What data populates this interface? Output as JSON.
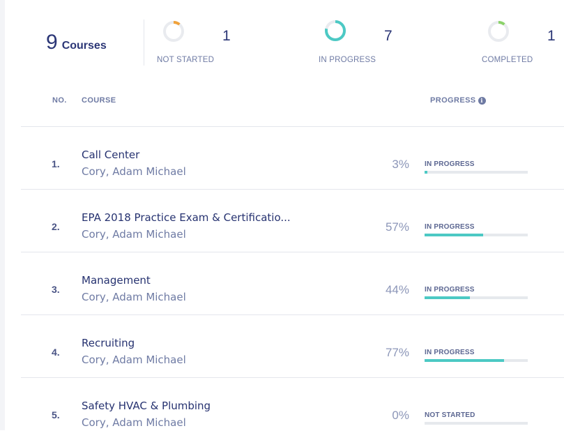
{
  "summary": {
    "total_count": "9",
    "total_label": "Courses",
    "stats": [
      {
        "count": "1",
        "label": "NOT STARTED",
        "color": "#f0a23b",
        "fraction": 0.11
      },
      {
        "count": "7",
        "label": "IN PROGRESS",
        "color": "#4cc9c4",
        "fraction": 0.78
      },
      {
        "count": "1",
        "label": "COMPLETED",
        "color": "#8bd26a",
        "fraction": 0.11
      }
    ]
  },
  "table": {
    "headers": {
      "no": "NO.",
      "course": "COURSE",
      "progress": "PROGRESS"
    },
    "info_icon": "info-icon",
    "rows": [
      {
        "no": "1.",
        "title": "Call Center",
        "author": "Cory, Adam Michael",
        "percent": "3%",
        "progress": 0.03,
        "status": "IN PROGRESS"
      },
      {
        "no": "2.",
        "title": "EPA 2018 Practice Exam & Certificatio...",
        "author": "Cory, Adam Michael",
        "percent": "57%",
        "progress": 0.57,
        "status": "IN PROGRESS"
      },
      {
        "no": "3.",
        "title": "Management",
        "author": "Cory, Adam Michael",
        "percent": "44%",
        "progress": 0.44,
        "status": "IN PROGRESS"
      },
      {
        "no": "4.",
        "title": "Recruiting",
        "author": "Cory, Adam Michael",
        "percent": "77%",
        "progress": 0.77,
        "status": "IN PROGRESS"
      },
      {
        "no": "5.",
        "title": "Safety HVAC & Plumbing",
        "author": "Cory, Adam Michael",
        "percent": "0%",
        "progress": 0.0,
        "status": "NOT STARTED"
      }
    ]
  },
  "colors": {
    "bar_fill": "#4cc9c4",
    "bar_track": "#e6e9ed",
    "ring_track": "#e9ebef"
  }
}
